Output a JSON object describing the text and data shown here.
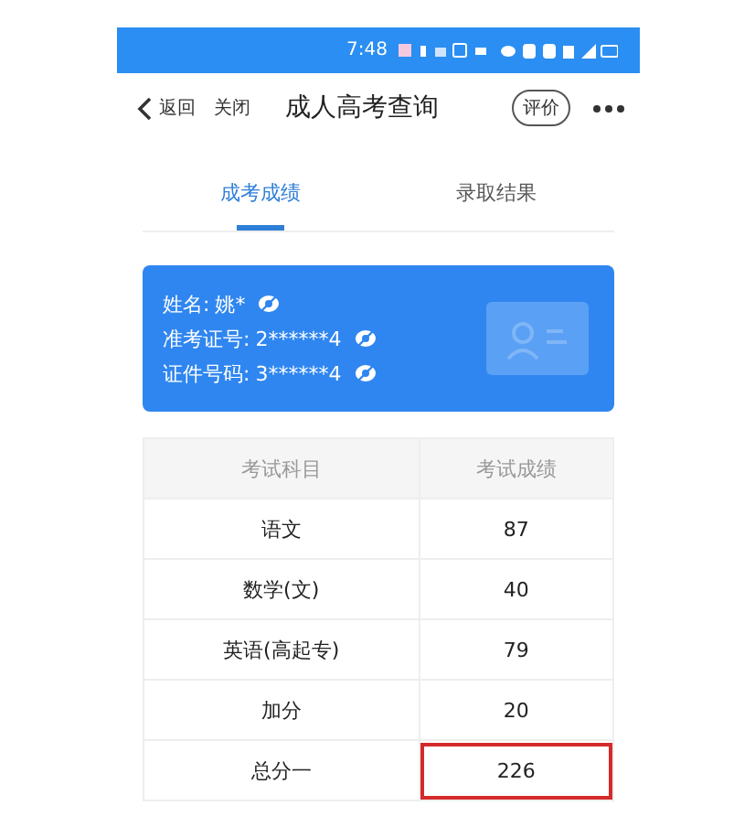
{
  "status_bar": {
    "time": "7:48"
  },
  "nav": {
    "back": "返回",
    "close": "关闭",
    "title": "成人高考查询",
    "rate": "评价"
  },
  "tabs": [
    {
      "label": "成考成绩",
      "selected": true
    },
    {
      "label": "录取结果",
      "selected": false
    }
  ],
  "card": {
    "fields": [
      {
        "label": "姓名:",
        "value": "姚*"
      },
      {
        "label": "准考证号:",
        "value": "2******4"
      },
      {
        "label": "证件号码:",
        "value": "3******4"
      }
    ]
  },
  "table": {
    "columns": [
      "考试科目",
      "考试成绩"
    ],
    "rows": [
      {
        "subject": "语文",
        "score": "87",
        "highlighted": false
      },
      {
        "subject": "数学(文)",
        "score": "40",
        "highlighted": false
      },
      {
        "subject": "英语(高起专)",
        "score": "79",
        "highlighted": false
      },
      {
        "subject": "加分",
        "score": "20",
        "highlighted": false
      },
      {
        "subject": "总分一",
        "score": "226",
        "highlighted": true
      }
    ]
  }
}
